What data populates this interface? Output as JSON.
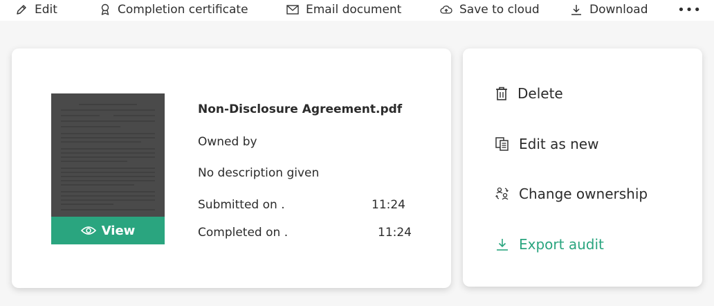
{
  "toolbar": {
    "edit": "Edit",
    "certificate": "Completion certificate",
    "email": "Email document",
    "cloud": "Save to cloud",
    "download": "Download",
    "more": "•••"
  },
  "document": {
    "filename": "Non-Disclosure Agreement.pdf",
    "owned_by": "Owned by",
    "description": "No description given",
    "submitted_label": "Submitted on .",
    "submitted_time": "11:24",
    "completed_label": "Completed on .",
    "completed_time": "11:24",
    "view_label": "View"
  },
  "menu": {
    "delete": "Delete",
    "edit_as_new": "Edit as new",
    "change_ownership": "Change ownership",
    "export_audit": "Export audit"
  },
  "colors": {
    "accent": "#2aa57f",
    "thumbnail": "#4a4a4a",
    "text": "#2b2b2b"
  }
}
